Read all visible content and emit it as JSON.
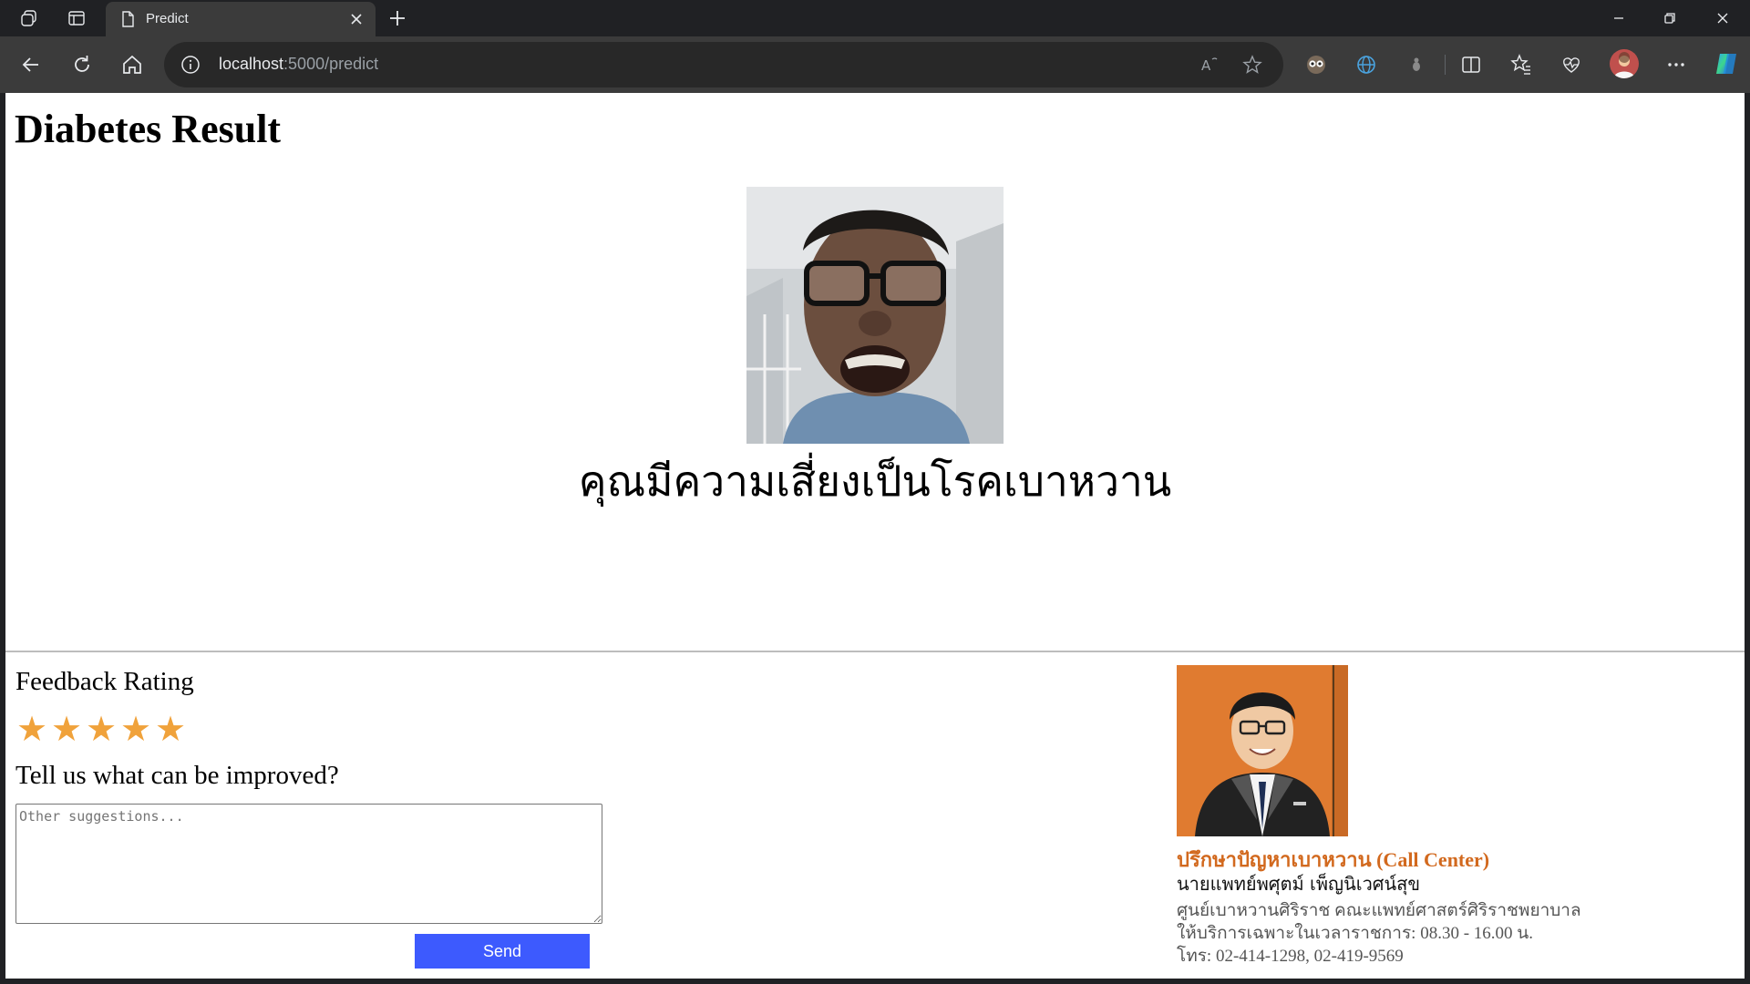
{
  "browser": {
    "tab_title": "Predict",
    "url_host": "localhost",
    "url_path": ":5000/predict"
  },
  "page": {
    "title": "Diabetes Result",
    "result_message": "คุณมีความเสี่ยงเป็นโรคเบาหวาน"
  },
  "feedback": {
    "title": "Feedback Rating",
    "rating": 5,
    "max_rating": 5,
    "star_glyph": "★",
    "star_color": "#f0a23b",
    "question": "Tell us what can be improved?",
    "placeholder": "Other suggestions...",
    "send_label": "Send",
    "send_color": "#3d5afe"
  },
  "call_center": {
    "title": "ปรึกษาปัญหาเบาหวาน (Call Center)",
    "title_color": "#d2691e",
    "doctor_name": "นายแพทย์พศุตม์ เพ็ญนิเวศน์สุข",
    "organization": "ศูนย์เบาหวานศิริราช คณะแพทย์ศาสตร์ศิริราชพยาบาล",
    "hours": "ให้บริการเฉพาะในเวลาราชการ: 08.30 - 16.00 น.",
    "phone": "โทร: 02-414-1298, 02-419-9569"
  },
  "icons": {
    "workspaces": "workspaces-icon",
    "tab_actions": "tab-actions-icon",
    "page": "page-icon",
    "close": "close-icon",
    "new_tab": "plus-icon",
    "back": "back-arrow-icon",
    "refresh": "refresh-icon",
    "home": "home-icon",
    "site_info": "info-icon",
    "read_aloud": "read-aloud-icon",
    "favorite": "star-outline-icon",
    "split": "split-screen-icon",
    "favorites": "favorites-icon",
    "browser_essentials": "heart-pulse-icon",
    "more": "more-icon",
    "copilot": "copilot-icon"
  }
}
